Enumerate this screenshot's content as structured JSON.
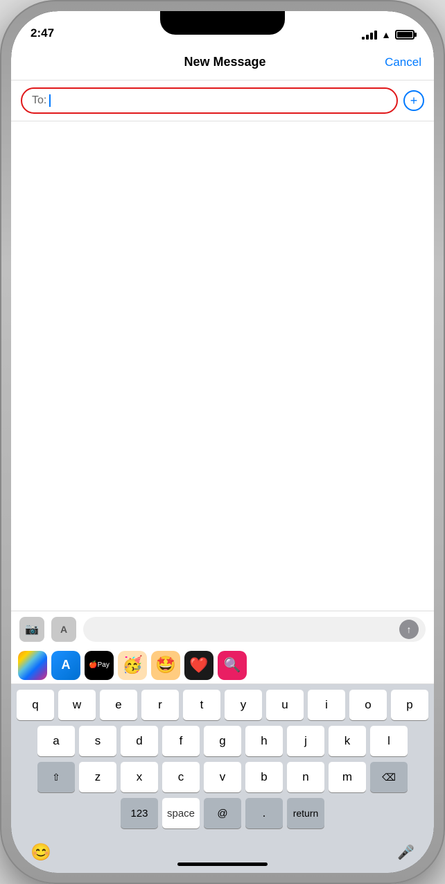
{
  "status_bar": {
    "time": "2:47",
    "signal": [
      4,
      7,
      10,
      13
    ],
    "battery_level": 100
  },
  "nav": {
    "title": "New Message",
    "cancel_label": "Cancel"
  },
  "to_field": {
    "label": "To:",
    "placeholder": ""
  },
  "apps_bar": {
    "camera_icon": "📷",
    "apps_icon": "A",
    "send_arrow": "↑"
  },
  "app_suggestions": [
    {
      "name": "Photos",
      "emoji": "🌅"
    },
    {
      "name": "App Store",
      "emoji": "🅰"
    },
    {
      "name": "Apple Pay",
      "text": "Pay"
    },
    {
      "name": "Memoji 1",
      "emoji": "🥳"
    },
    {
      "name": "Memoji 2",
      "emoji": "🤩"
    },
    {
      "name": "Heart App",
      "emoji": "❤️"
    },
    {
      "name": "Search",
      "emoji": "🔍"
    }
  ],
  "keyboard": {
    "rows": [
      [
        "q",
        "w",
        "e",
        "r",
        "t",
        "y",
        "u",
        "i",
        "o",
        "p"
      ],
      [
        "a",
        "s",
        "d",
        "f",
        "g",
        "h",
        "j",
        "k",
        "l"
      ],
      [
        "z",
        "x",
        "c",
        "v",
        "b",
        "n",
        "m"
      ]
    ],
    "special": {
      "shift": "⇧",
      "delete": "⌫",
      "numbers": "123",
      "space": "space",
      "at": "@",
      "period": ".",
      "return": "return"
    }
  },
  "bottom_bar": {
    "emoji_label": "😊",
    "mic_label": "🎤"
  }
}
